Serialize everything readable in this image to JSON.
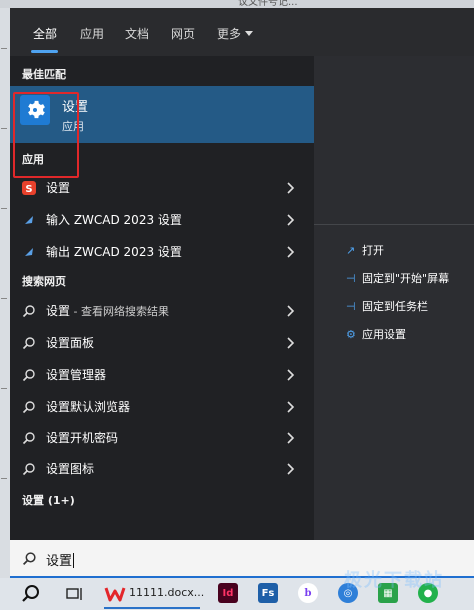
{
  "top_strip_text": "议文件号记...",
  "tabs": [
    {
      "label": "全部",
      "active": true
    },
    {
      "label": "应用",
      "active": false
    },
    {
      "label": "文档",
      "active": false
    },
    {
      "label": "网页",
      "active": false
    },
    {
      "label": "更多",
      "active": false
    }
  ],
  "sections": {
    "best_match": "最佳匹配",
    "apps": "应用",
    "web": "搜索网页",
    "settings": "设置 (1+)"
  },
  "best_match": {
    "title": "设置",
    "subtitle": "应用"
  },
  "app_results": [
    {
      "label": "设置",
      "icon": "sogou-icon"
    },
    {
      "label": "输入 ZWCAD 2023 设置",
      "icon": "zwcad-icon"
    },
    {
      "label": "输出 ZWCAD 2023 设置",
      "icon": "zwcad-icon"
    }
  ],
  "web_results": [
    {
      "label": "设置",
      "suffix": " - 查看网络搜索结果"
    },
    {
      "label": "设置面板",
      "suffix": ""
    },
    {
      "label": "设置管理器",
      "suffix": ""
    },
    {
      "label": "设置默认浏览器",
      "suffix": ""
    },
    {
      "label": "设置开机密码",
      "suffix": ""
    },
    {
      "label": "设置图标",
      "suffix": ""
    }
  ],
  "context_menu": [
    {
      "label": "打开",
      "icon": "open-icon"
    },
    {
      "label": "固定到\"开始\"屏幕",
      "icon": "pin-icon"
    },
    {
      "label": "固定到任务栏",
      "icon": "pin-icon"
    },
    {
      "label": "应用设置",
      "icon": "gear-icon"
    }
  ],
  "search": {
    "value": "设置"
  },
  "taskbar": {
    "wps_label": "11111.docx...",
    "apps": [
      "Id",
      "Fs",
      "b"
    ]
  },
  "watermark": "极光下载站",
  "colors": {
    "accent": "#4fa3f0",
    "highlight": "#245a86",
    "annotation": "#e0282a"
  }
}
